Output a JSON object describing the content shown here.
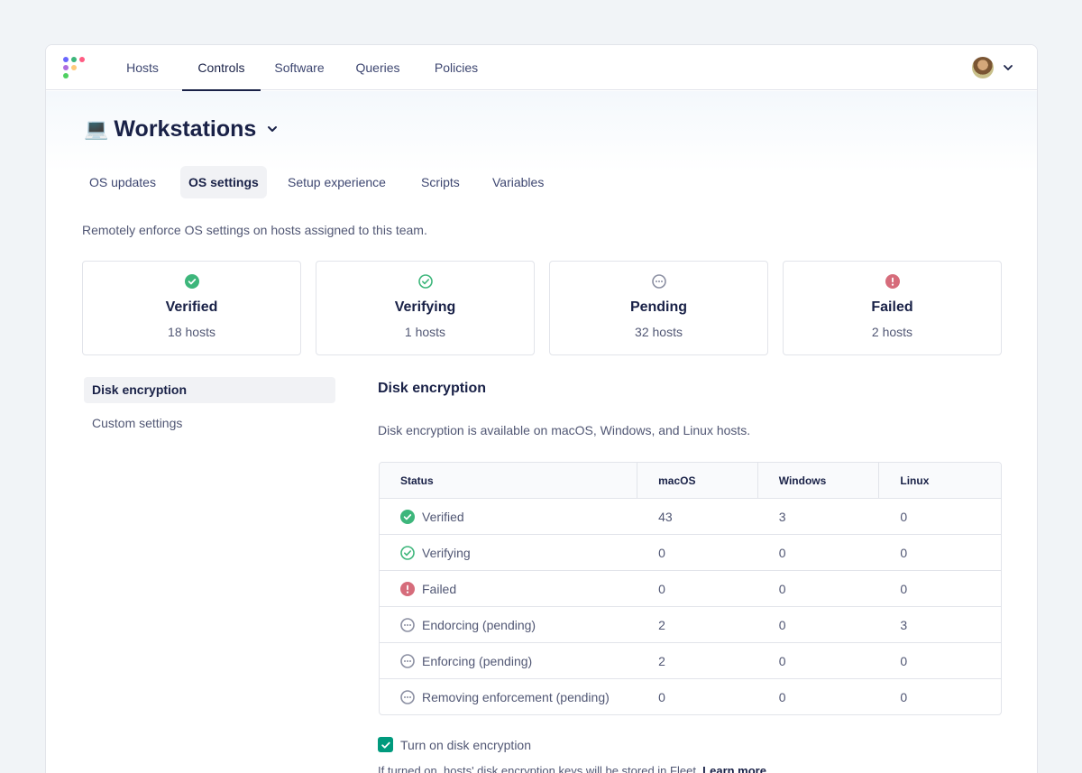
{
  "nav": {
    "items": [
      {
        "label": "Hosts",
        "active": false
      },
      {
        "label": "Controls",
        "active": true
      },
      {
        "label": "Software",
        "active": false
      },
      {
        "label": "Queries",
        "active": false
      },
      {
        "label": "Policies",
        "active": false
      }
    ]
  },
  "team": {
    "emoji": "💻",
    "name": "Workstations"
  },
  "tabs": [
    {
      "label": "OS updates",
      "active": false
    },
    {
      "label": "OS settings",
      "active": true
    },
    {
      "label": "Setup experience",
      "active": false
    },
    {
      "label": "Scripts",
      "active": false
    },
    {
      "label": "Variables",
      "active": false
    }
  ],
  "description": "Remotely enforce OS settings on hosts assigned to this team.",
  "summary_cards": [
    {
      "title": "Verified",
      "count": "18 hosts",
      "icon": "check-filled-icon"
    },
    {
      "title": "Verifying",
      "count": "1 hosts",
      "icon": "check-outline-icon"
    },
    {
      "title": "Pending",
      "count": "32 hosts",
      "icon": "pending-icon"
    },
    {
      "title": "Failed",
      "count": "2 hosts",
      "icon": "error-icon"
    }
  ],
  "sidenav": {
    "items": [
      {
        "label": "Disk encryption",
        "active": true
      },
      {
        "label": "Custom settings",
        "active": false
      }
    ]
  },
  "disk_encryption": {
    "title": "Disk encryption",
    "description": "Disk encryption is available on macOS, Windows, and Linux hosts.",
    "table": {
      "headers": [
        "Status",
        "macOS",
        "Windows",
        "Linux"
      ],
      "rows": [
        {
          "status": "Verified",
          "icon": "check-filled-icon",
          "macos": "43",
          "windows": "3",
          "linux": "0"
        },
        {
          "status": "Verifying",
          "icon": "check-outline-icon",
          "macos": "0",
          "windows": "0",
          "linux": "0"
        },
        {
          "status": "Failed",
          "icon": "error-icon",
          "macos": "0",
          "windows": "0",
          "linux": "0"
        },
        {
          "status": "Endorcing (pending)",
          "icon": "pending-icon",
          "macos": "2",
          "windows": "0",
          "linux": "3"
        },
        {
          "status": "Enforcing (pending)",
          "icon": "pending-icon",
          "macos": "2",
          "windows": "0",
          "linux": "0"
        },
        {
          "status": "Removing enforcement (pending)",
          "icon": "pending-icon",
          "macos": "0",
          "windows": "0",
          "linux": "0"
        }
      ]
    },
    "checkbox": {
      "label": "Turn on disk encryption",
      "checked": true
    },
    "note": {
      "text": "If turned on, hosts' disk encryption keys will be stored in Fleet.",
      "link": "Learn more"
    }
  },
  "colors": {
    "success": "#3db67b",
    "error": "#d66c7b",
    "pending": "#8b8fa2",
    "checkbox": "#009a7d",
    "text": "#192147"
  }
}
